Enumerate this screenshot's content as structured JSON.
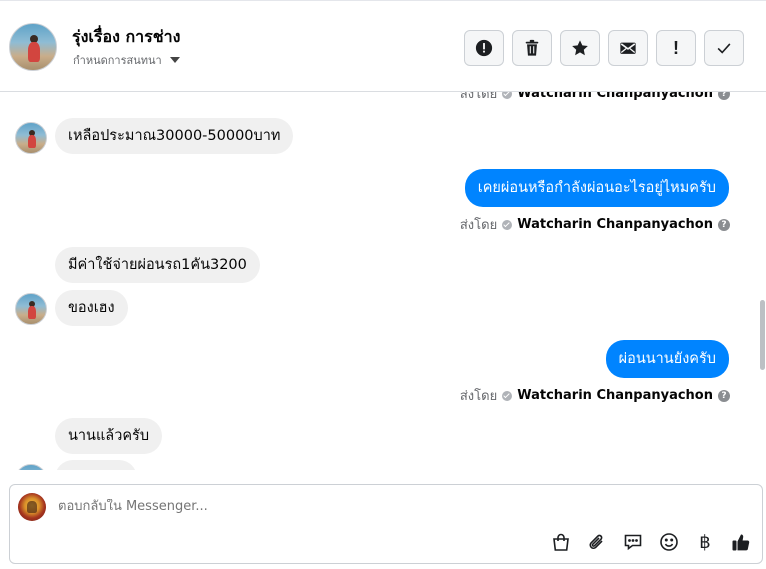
{
  "header": {
    "contact_name": "รุ่งเรื่อง การช่าง",
    "subtitle": "กำหนดการสนทนา",
    "actions": [
      {
        "name": "report-button",
        "icon": "alert-circle-icon"
      },
      {
        "name": "delete-button",
        "icon": "trash-icon"
      },
      {
        "name": "star-button",
        "icon": "star-icon"
      },
      {
        "name": "mark-unread-button",
        "icon": "envelope-icon"
      },
      {
        "name": "important-button",
        "icon": "exclamation-icon",
        "glyph": "!"
      },
      {
        "name": "mark-done-button",
        "icon": "check-icon"
      }
    ]
  },
  "messages": {
    "sent_by_prefix": "ส่งโดย",
    "sender_name": "Watcharin Chanpanyachon",
    "m1": "เหลือประมาณ30000-50000บาท",
    "m2": "เคยผ่อนหรือกำลังผ่อนอะไรอยู่ไหมครับ",
    "m3": "มีค่าใช้จ่ายผ่อนรถ1คัน3200",
    "m4": "ของเฮง",
    "m5": "ผ่อนนานยังครับ",
    "m6": "นานแล้วครับ"
  },
  "composer": {
    "placeholder": "ตอบกลับใน Messenger...",
    "baht_glyph": "฿",
    "tools": [
      "shopping-bag-icon",
      "paperclip-icon",
      "chat-bubble-icon",
      "emoji-icon",
      "baht-icon",
      "thumbs-up-icon"
    ]
  },
  "colors": {
    "outgoing_bubble": "#0084ff",
    "incoming_bubble": "#f0f0f0"
  }
}
